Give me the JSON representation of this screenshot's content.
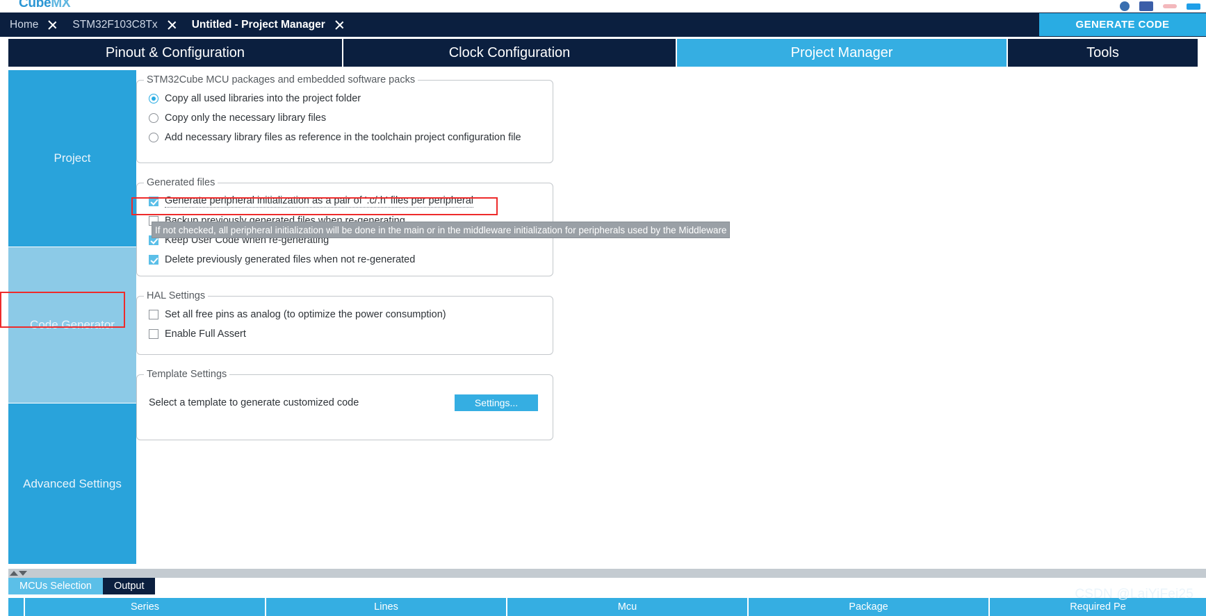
{
  "app": {
    "logo_primary": "Cube",
    "logo_secondary": "MX"
  },
  "breadcrumb": {
    "items": [
      {
        "label": "Home",
        "active": false
      },
      {
        "label": "STM32F103C8Tx",
        "active": false
      },
      {
        "label": "Untitled - Project Manager",
        "active": true
      }
    ]
  },
  "header": {
    "generate_code_label": "GENERATE CODE"
  },
  "tabs": [
    {
      "label": "Pinout & Configuration",
      "active": false
    },
    {
      "label": "Clock Configuration",
      "active": false
    },
    {
      "label": "Project Manager",
      "active": true
    },
    {
      "label": "Tools",
      "active": false
    }
  ],
  "sidebar": {
    "items": [
      {
        "label": "Project",
        "selected": false
      },
      {
        "label": "Code Generator",
        "selected": true
      },
      {
        "label": "Advanced Settings",
        "selected": false
      }
    ]
  },
  "groups": {
    "packages": {
      "title": "STM32Cube MCU packages and embedded software packs",
      "options": [
        {
          "label": "Copy all used libraries into the project folder",
          "checked": true
        },
        {
          "label": "Copy only the necessary library files",
          "checked": false
        },
        {
          "label": "Add necessary library files as reference in the toolchain project configuration file",
          "checked": false
        }
      ]
    },
    "generated_files": {
      "title": "Generated files",
      "options": [
        {
          "label": "Generate peripheral initialization as a pair of '.c/.h' files per peripheral",
          "checked": true
        },
        {
          "label": "Backup previously generated files when re-generating",
          "checked": false
        },
        {
          "label": "Keep User Code when re-generating",
          "checked": true
        },
        {
          "label": "Delete previously generated files when not re-generated",
          "checked": true
        }
      ]
    },
    "hal_settings": {
      "title": "HAL Settings",
      "options": [
        {
          "label": "Set all free pins as analog (to optimize the power consumption)",
          "checked": false
        },
        {
          "label": "Enable Full Assert",
          "checked": false
        }
      ]
    },
    "template_settings": {
      "title": "Template Settings",
      "description": "Select a template to generate customized code",
      "button_label": "Settings..."
    }
  },
  "tooltip": {
    "text": "If not checked, all peripheral initialization will be done in the main or in the middleware initialization for peripherals used by the Middleware"
  },
  "bottom": {
    "tabs": [
      {
        "label": "MCUs Selection",
        "selected": true
      },
      {
        "label": "Output",
        "selected": false
      }
    ],
    "table_headers": [
      "Series",
      "Lines",
      "Mcu",
      "Package",
      "Required Pe"
    ]
  },
  "watermark": {
    "text": "CSDN @LaiYiFei25"
  },
  "colors": {
    "navy": "#0b1f3f",
    "accent_blue": "#35aee2",
    "light_blue": "#8ccae7",
    "annotation_red": "#ee2b2b",
    "tooltip_gray": "#9aa0a6"
  }
}
